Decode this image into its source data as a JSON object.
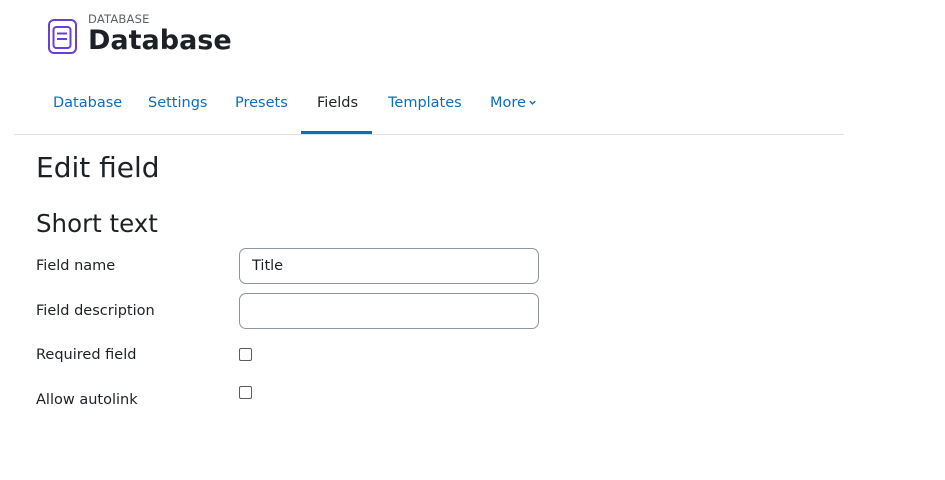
{
  "header": {
    "icon": "database-icon",
    "subtitle": "DATABASE",
    "title": "Database"
  },
  "tabs": [
    {
      "label": "Database",
      "active": false
    },
    {
      "label": "Settings",
      "active": false
    },
    {
      "label": "Presets",
      "active": false
    },
    {
      "label": "Fields",
      "active": true
    },
    {
      "label": "Templates",
      "active": false
    },
    {
      "label": "More",
      "active": false,
      "icon": "chevron-down-icon"
    }
  ],
  "page": {
    "heading": "Edit field",
    "section": "Short text"
  },
  "form": {
    "field_name": {
      "label": "Field name",
      "value": "Title"
    },
    "field_description": {
      "label": "Field description",
      "value": ""
    },
    "required_field": {
      "label": "Required field",
      "checked": false
    },
    "allow_autolink": {
      "label": "Allow autolink",
      "checked": false
    }
  },
  "colors": {
    "accent": "#0f6cbf",
    "icon": "#6a3fd9",
    "text": "#1d2125"
  }
}
